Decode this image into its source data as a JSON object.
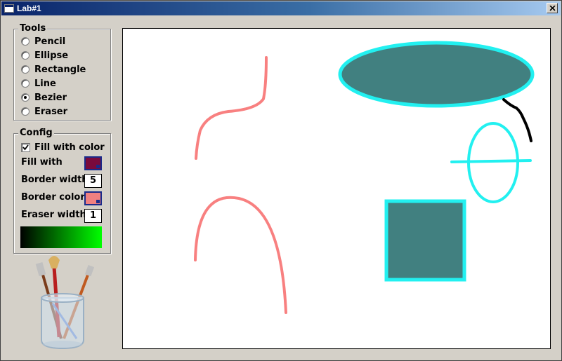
{
  "window": {
    "title": "Lab#1"
  },
  "tools": {
    "title": "Tools",
    "items": [
      {
        "label": "Pencil",
        "checked": false
      },
      {
        "label": "Ellipse",
        "checked": false
      },
      {
        "label": "Rectangle",
        "checked": false
      },
      {
        "label": "Line",
        "checked": false
      },
      {
        "label": "Bezier",
        "checked": true
      },
      {
        "label": "Eraser",
        "checked": false
      }
    ]
  },
  "config": {
    "title": "Config",
    "fill_with_color_label": "Fill with color",
    "fill_with_color_checked": true,
    "fill_with_label": "Fill with",
    "fill_color": "#7a0a3c",
    "border_width_label": "Border width",
    "border_width_value": "5",
    "border_color_label": "Border color",
    "border_color": "#f08080",
    "eraser_width_label": "Eraser width",
    "eraser_width_value": "1",
    "gradient_colors": [
      "#000000",
      "#00ff00"
    ]
  },
  "colors": {
    "shape_fill": "#418080",
    "shape_border": "#22f0f0",
    "bezier_stroke": "#f88080",
    "pencil_stroke": "#000000"
  }
}
